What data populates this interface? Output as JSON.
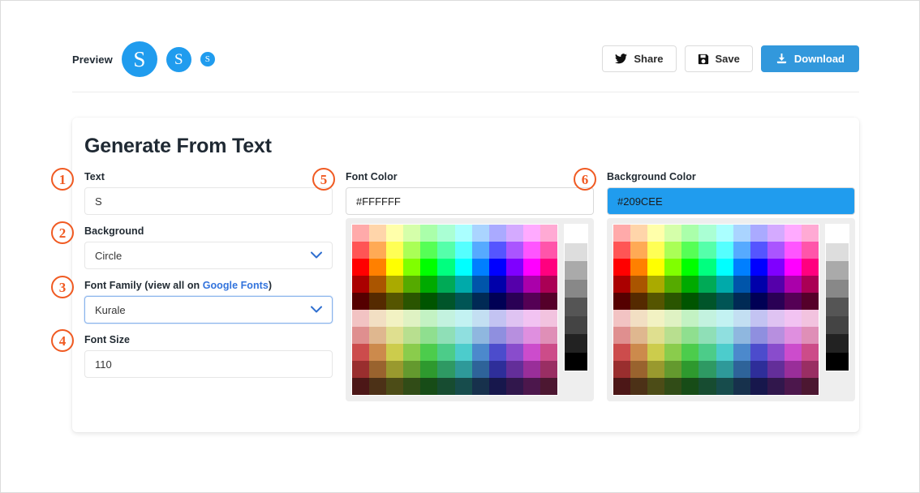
{
  "preview": {
    "label": "Preview",
    "avatar_text": "S",
    "avatar_bg": "#209CEE",
    "avatar_fg": "#FFFFFF",
    "sizes": [
      "lg",
      "md",
      "sm"
    ]
  },
  "actions": {
    "share_label": "Share",
    "save_label": "Save",
    "download_label": "Download",
    "primary_color": "#3298DC"
  },
  "card": {
    "title": "Generate From Text",
    "annotations": [
      "1",
      "2",
      "3",
      "4",
      "5",
      "6"
    ],
    "annotation_color": "#F05A22",
    "fields": {
      "text": {
        "label": "Text",
        "value": "S"
      },
      "background": {
        "label": "Background",
        "value": "Circle"
      },
      "font_family": {
        "label_prefix": "Font Family (view all on ",
        "label_link": "Google Fonts",
        "label_suffix": ")",
        "value": "Kurale"
      },
      "font_size": {
        "label": "Font Size",
        "value": "110"
      },
      "font_color": {
        "label": "Font Color",
        "value": "#FFFFFF",
        "swatch": "#FFFFFF"
      },
      "background_color": {
        "label": "Background Color",
        "value": "#209CEE",
        "swatch": "#209CEE"
      }
    }
  },
  "palette": {
    "columns": 12,
    "rows": 10,
    "colors": [
      "#FFAAAA",
      "#FFD5AA",
      "#FFFFAA",
      "#D5FFAA",
      "#AAFFAA",
      "#AAFFD4",
      "#AAFFFF",
      "#AAD4FF",
      "#AAAAFF",
      "#D4AAFF",
      "#FFAAFF",
      "#FFAAD4",
      "#FF5555",
      "#FFAA55",
      "#FFFF55",
      "#AAFF56",
      "#56FF56",
      "#55FFAA",
      "#55FFFF",
      "#56AAFF",
      "#5555FF",
      "#AA55FF",
      "#FF55FF",
      "#FF55AA",
      "#FF0000",
      "#FF8000",
      "#FFFF00",
      "#80FF00",
      "#00FF00",
      "#00FF7F",
      "#00FFFF",
      "#007FFF",
      "#0000FF",
      "#7F00FF",
      "#FF00FF",
      "#FF007F",
      "#AA0000",
      "#AA5500",
      "#AAAA00",
      "#55AA00",
      "#00AA00",
      "#00AA56",
      "#00AAAA",
      "#0055AA",
      "#0000AA",
      "#5500AA",
      "#AA00AA",
      "#AA0055",
      "#550000",
      "#552A00",
      "#555500",
      "#2A5500",
      "#005500",
      "#00552A",
      "#005555",
      "#002A55",
      "#000055",
      "#2A0055",
      "#550055",
      "#55002A",
      "#F2C3C3",
      "#F2DFC3",
      "#F2F2C3",
      "#DFF2C3",
      "#C3F2C3",
      "#C3F2DF",
      "#C3F2F2",
      "#C3DFF2",
      "#C3C3F2",
      "#DFC3F2",
      "#F2C3F2",
      "#F2C3DF",
      "#DF8F8F",
      "#DFB78F",
      "#DFDF8F",
      "#B8DF8F",
      "#8FDF8F",
      "#8FDFB7",
      "#8FDFDF",
      "#8FB7DF",
      "#8F8FDF",
      "#B78FDF",
      "#DF8FDF",
      "#DF8FB7",
      "#CC4C4C",
      "#CC8A4C",
      "#CCCC4C",
      "#8ACC4C",
      "#4CCC4C",
      "#4CCC89",
      "#4CCCCC",
      "#4C89CC",
      "#4C4CCC",
      "#894CCC",
      "#CC4CCC",
      "#CC4C89",
      "#992E2E",
      "#99632E",
      "#99992E",
      "#64992E",
      "#2E992E",
      "#2E9963",
      "#2E9999",
      "#2E6399",
      "#2E2E99",
      "#632E99",
      "#992E99",
      "#992E63",
      "#4C1717",
      "#4C3117",
      "#4C4C17",
      "#314C17",
      "#174C17",
      "#174C31",
      "#174C4C",
      "#17314C",
      "#17174C",
      "#31174C",
      "#4C174C",
      "#4C1731"
    ],
    "grays": [
      "#FFFFFF",
      "#DDDDDD",
      "#AAAAAA",
      "#888888",
      "#555555",
      "#444444",
      "#222222",
      "#000000"
    ]
  }
}
